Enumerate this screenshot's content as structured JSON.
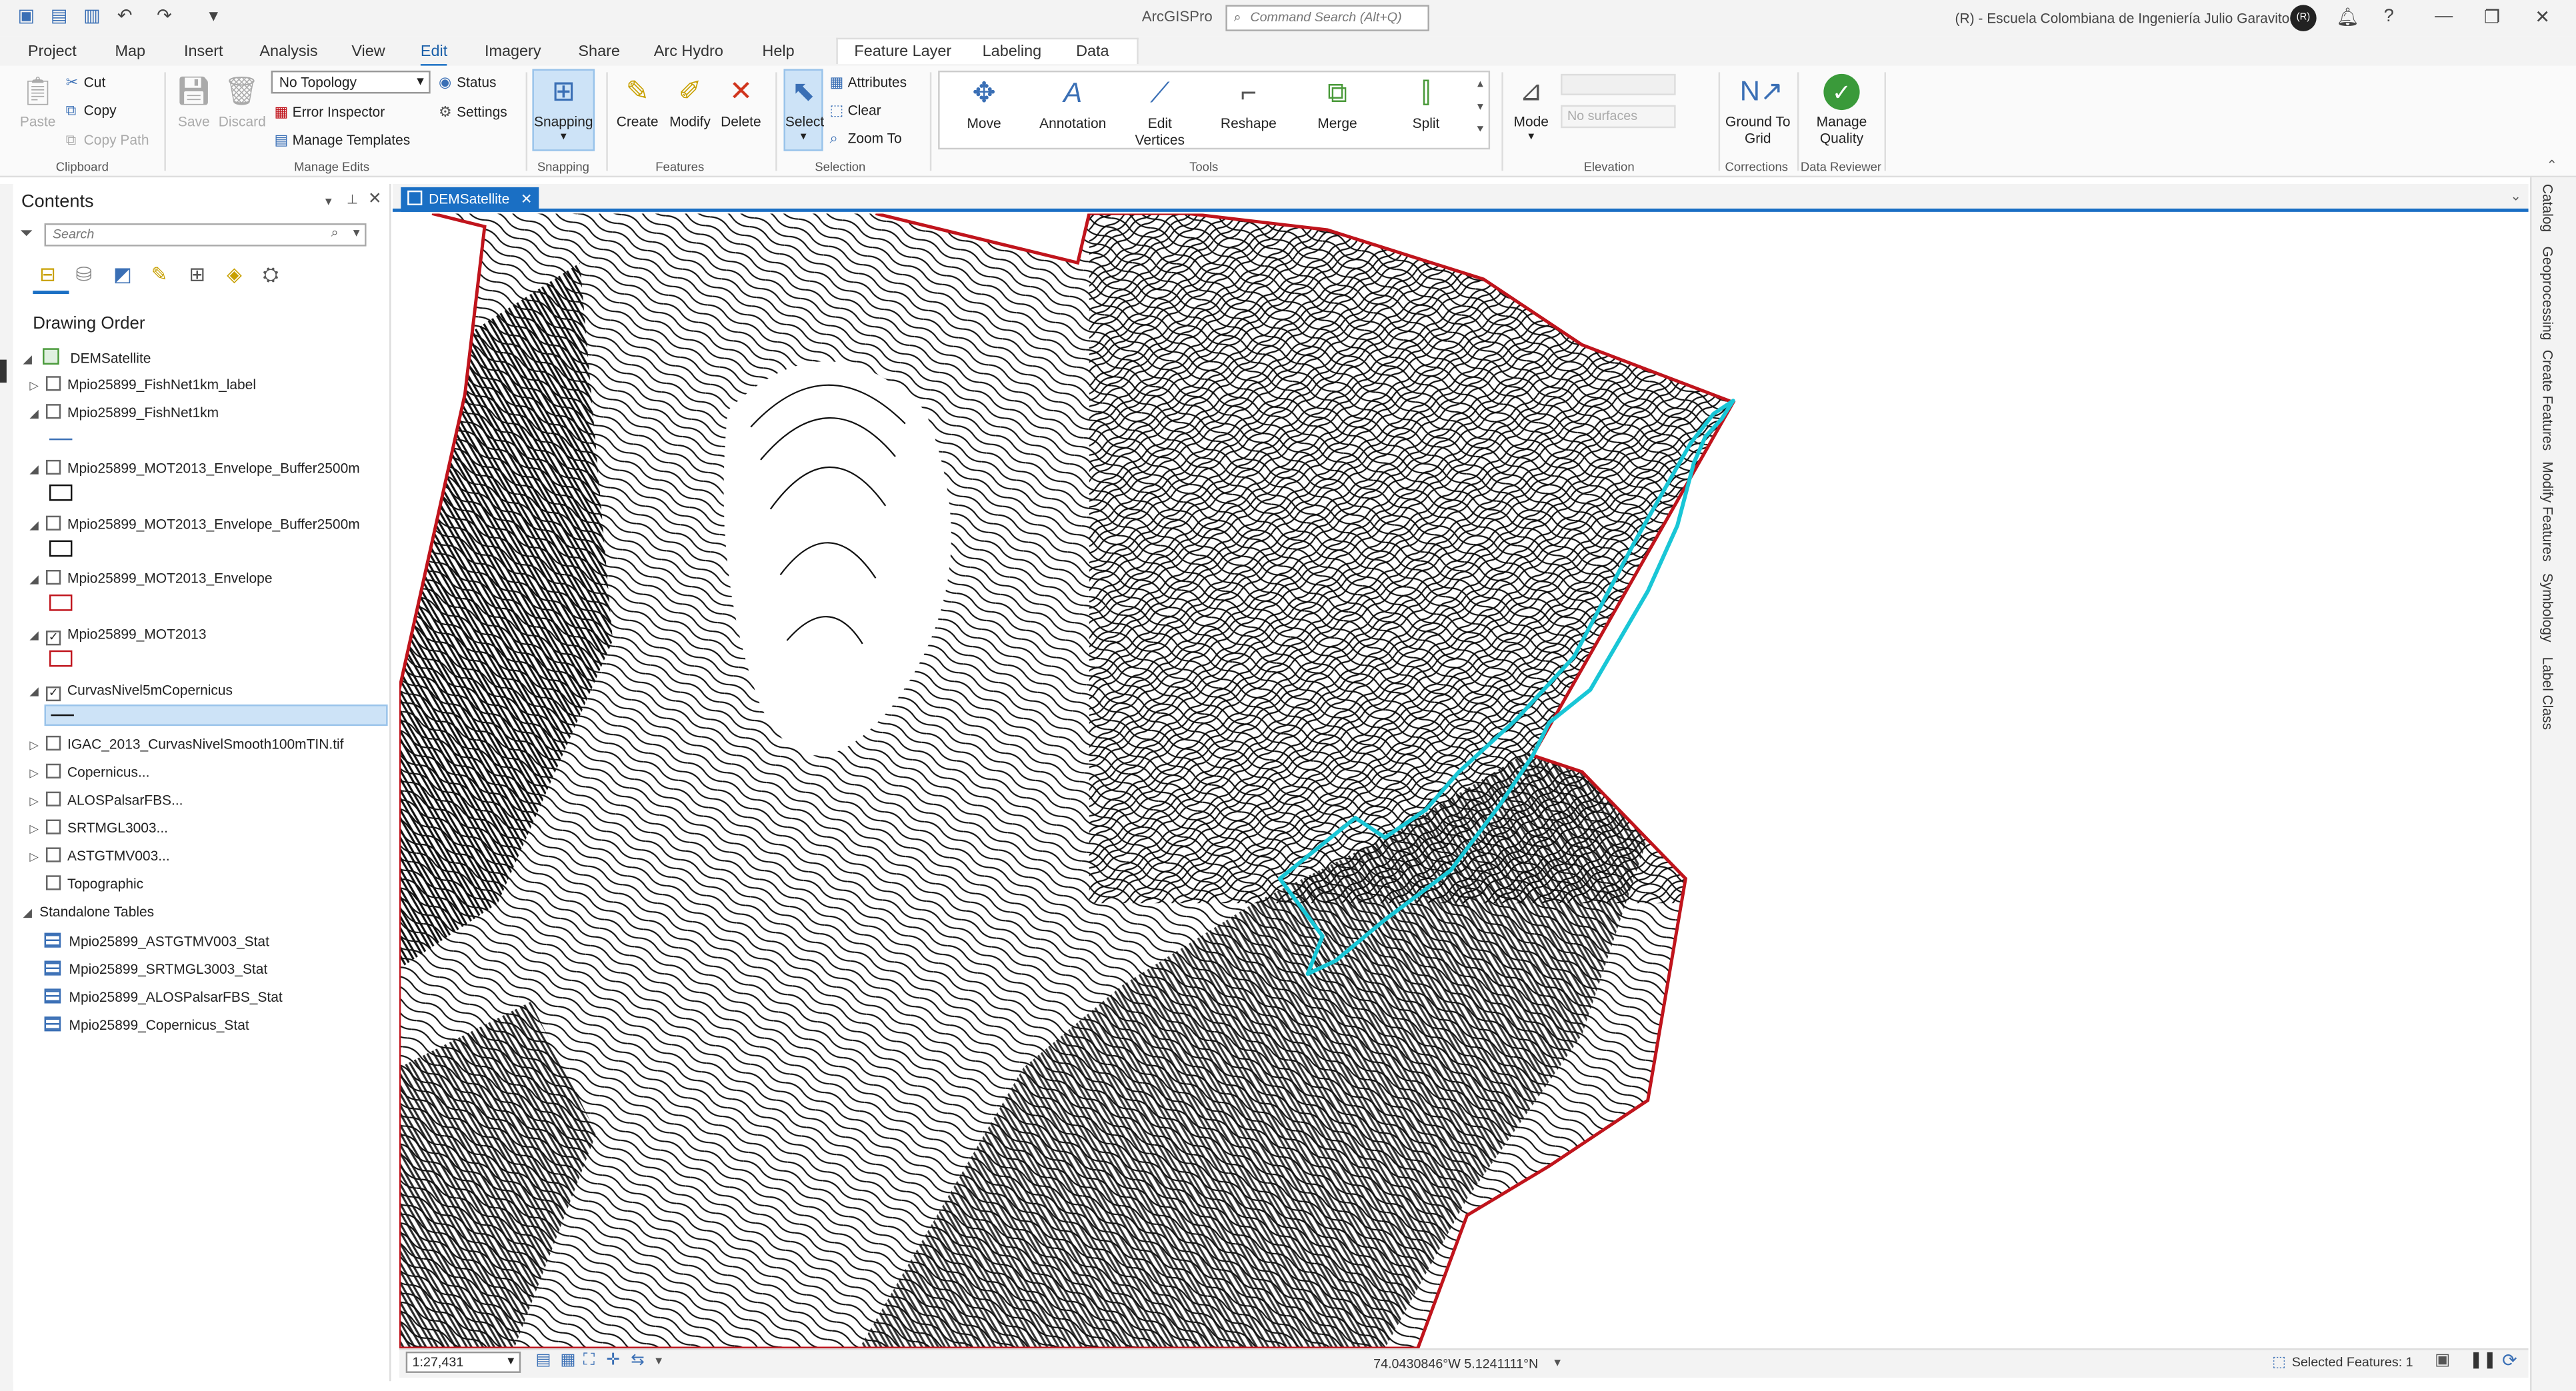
{
  "window": {
    "app_title": "ArcGISPro",
    "command_search_placeholder": "Command Search (Alt+Q)",
    "org_name": "(R) - Escuela Colombiana de Ingeniería Julio Garavito",
    "avatar_initials": "(R)"
  },
  "tabs": [
    "Project",
    "Map",
    "Insert",
    "Analysis",
    "View",
    "Edit",
    "Imagery",
    "Share",
    "Arc Hydro",
    "Help",
    "Feature Layer",
    "Labeling",
    "Data"
  ],
  "active_tab": "Edit",
  "ribbon": {
    "clipboard": {
      "paste": "Paste",
      "cut": "Cut",
      "copy": "Copy",
      "copy_path": "Copy Path",
      "label": "Clipboard"
    },
    "manage_edits": {
      "save": "Save",
      "discard": "Discard",
      "topology": "No Topology",
      "status": "Status",
      "error_inspector": "Error Inspector",
      "settings": "Settings",
      "manage_templates": "Manage Templates",
      "label": "Manage Edits"
    },
    "snapping": {
      "button": "Snapping",
      "label": "Snapping"
    },
    "features": {
      "create": "Create",
      "modify": "Modify",
      "delete": "Delete",
      "label": "Features"
    },
    "selection": {
      "select": "Select",
      "attributes": "Attributes",
      "clear": "Clear",
      "zoom_to": "Zoom To",
      "label": "Selection"
    },
    "tools": {
      "move": "Move",
      "annotation": "Annotation",
      "edit_vertices": "Edit Vertices",
      "reshape": "Reshape",
      "merge": "Merge",
      "split": "Split",
      "label": "Tools"
    },
    "elevation": {
      "mode": "Mode",
      "surfaces": "No surfaces",
      "label": "Elevation"
    },
    "corrections": {
      "ground_to_grid": "Ground To Grid",
      "label": "Corrections"
    },
    "data_reviewer": {
      "manage_quality": "Manage Quality",
      "label": "Data Reviewer"
    }
  },
  "contents": {
    "title": "Contents",
    "search_placeholder": "Search",
    "drawing_order": "Drawing Order",
    "map_name": "DEMSatellite",
    "layers": [
      {
        "name": "Mpio25899_FishNet1km_label",
        "checked": false
      },
      {
        "name": "Mpio25899_FishNet1km",
        "checked": false
      },
      {
        "name": "Mpio25899_MOT2013_Envelope_Buffer2500m",
        "checked": false
      },
      {
        "name": "Mpio25899_MOT2013_Envelope_Buffer2500m",
        "checked": false
      },
      {
        "name": "Mpio25899_MOT2013_Envelope",
        "checked": false
      },
      {
        "name": "Mpio25899_MOT2013",
        "checked": true
      },
      {
        "name": "CurvasNivel5mCopernicus",
        "checked": true
      },
      {
        "name": "IGAC_2013_CurvasNivelSmooth100mTIN.tif",
        "checked": false
      },
      {
        "name": "Copernicus...",
        "checked": false
      },
      {
        "name": "ALOSPalsarFBS...",
        "checked": false
      },
      {
        "name": "SRTMGL3003...",
        "checked": false
      },
      {
        "name": "ASTGTMV003...",
        "checked": false
      },
      {
        "name": "Topographic",
        "checked": false
      }
    ],
    "standalone_tables_label": "Standalone Tables",
    "tables": [
      "Mpio25899_ASTGTMV003_Stat",
      "Mpio25899_SRTMGL3003_Stat",
      "Mpio25899_ALOSPalsarFBS_Stat",
      "Mpio25899_Copernicus_Stat"
    ]
  },
  "map_view": {
    "tab_label": "DEMSatellite",
    "scale": "1:27,431",
    "coordinates": "74.0430846°W 5.1241111°N",
    "selected_features": "Selected Features: 1",
    "boundary_color": "#c0141c",
    "selection_color": "#19c6d6"
  },
  "right_dock": [
    "Catalog",
    "Geoprocessing",
    "Create Features",
    "Modify Features",
    "Symbology",
    "Label Class"
  ],
  "colors": {
    "accent": "#1a6fc4",
    "ribbon_active": "#cde3f7"
  }
}
